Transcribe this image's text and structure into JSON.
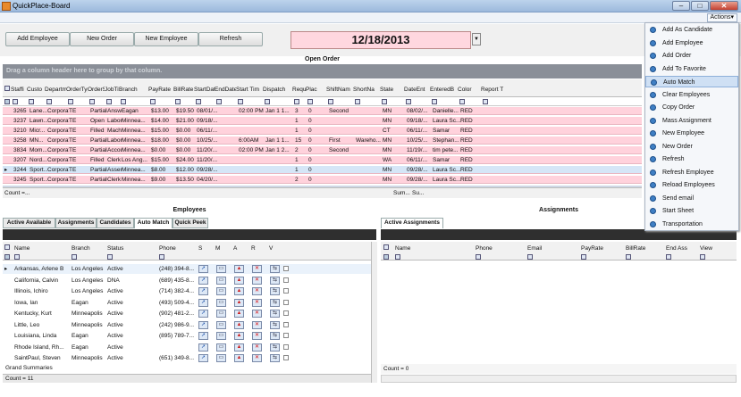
{
  "window": {
    "title": "QuickPlace-Board",
    "actions_label": "Actions"
  },
  "toolbar": {
    "add_employee": "Add Employee",
    "new_order": "New Order",
    "new_employee": "New Employee",
    "refresh": "Refresh",
    "date": "12/18/2013"
  },
  "open_order": {
    "title": "Open Order",
    "group_hint": "Drag a column header here to group by that column.",
    "columns": [
      "Staffi",
      "Custo",
      "Departmen",
      "OrderTyp",
      "OrderSta",
      "JobTitle",
      "Branch",
      "PayRate",
      "BillRate",
      "StartDat",
      "EndDate",
      "Start Tim",
      "Dispatch",
      "Requi",
      "Plac",
      "ShiftNam",
      "ShortNa",
      "State",
      "DateEnt",
      "EnteredB",
      "Color",
      "Report T"
    ],
    "rows": [
      [
        "3265",
        "Lane...",
        "Corporate",
        "TE",
        "Partially...",
        "Answeri...",
        "Eagan",
        "$13.00",
        "$19.50",
        "08/01/...",
        "",
        "02:00 PM",
        "Jan 1 1...",
        "3",
        "0",
        "Second",
        "",
        "MN",
        "08/02/...",
        "Danielle...",
        "RED",
        ""
      ],
      [
        "3237",
        "Lawn...",
        "Corporate",
        "TE",
        "Open",
        "Labor",
        "Minnea...",
        "$14.00",
        "$21.00",
        "09/18/...",
        "",
        "",
        "",
        "1",
        "0",
        "",
        "",
        "MN",
        "09/18/...",
        "Laura Sc...",
        "RED",
        ""
      ],
      [
        "3210",
        "Micr...",
        "Corporate",
        "TE",
        "Filled",
        "Machinist",
        "Minnea...",
        "$15.00",
        "$0.00",
        "06/11/...",
        "",
        "",
        "",
        "1",
        "0",
        "",
        "",
        "CT",
        "06/11/...",
        "Samar",
        "RED",
        ""
      ],
      [
        "3258",
        "MN...",
        "Corporate",
        "TE",
        "Partially...",
        "Labor",
        "Minnea...",
        "$18.00",
        "$0.00",
        "10/25/...",
        "",
        "6:00AM",
        "Jan 1 1...",
        "15",
        "0",
        "First",
        "Wareho...",
        "MN",
        "10/25/...",
        "Stephan...",
        "RED",
        ""
      ],
      [
        "3834",
        "Mom...",
        "Corporate",
        "TE",
        "Partially...",
        "Account...",
        "Minnea...",
        "$0.00",
        "$0.00",
        "11/20/...",
        "",
        "02:00 PM",
        "Jan 1 2...",
        "2",
        "0",
        "Second",
        "",
        "MN",
        "11/19/...",
        "tim pete...",
        "RED",
        ""
      ],
      [
        "3207",
        "Nord...",
        "Corporate",
        "TE",
        "Filled",
        "Clerk",
        "Los Ang...",
        "$15.00",
        "$24.00",
        "11/20/...",
        "",
        "",
        "",
        "1",
        "0",
        "",
        "",
        "WA",
        "06/11/...",
        "Samar",
        "RED",
        ""
      ],
      [
        "3244",
        "Sport...",
        "Corporate",
        "TE",
        "Partially...",
        "Assembly",
        "Minnea...",
        "$8.00",
        "$12.00",
        "09/28/...",
        "",
        "",
        "",
        "1",
        "0",
        "",
        "",
        "MN",
        "09/28/...",
        "Laura Sc...",
        "RED",
        ""
      ],
      [
        "3245",
        "Sport...",
        "Corporate",
        "TE",
        "Partially...",
        "Clerk",
        "Minnea...",
        "$9.00",
        "$13.50",
        "04/20/...",
        "",
        "",
        "",
        "2",
        "0",
        "",
        "",
        "MN",
        "09/28/...",
        "Laura Sc...",
        "RED",
        ""
      ]
    ],
    "footer_count": "Count =...",
    "footer_sum1": "Sum...",
    "footer_sum2": "Su..."
  },
  "employees": {
    "title": "Employees",
    "tabs": [
      "Active Available",
      "Assignments",
      "Candidates",
      "Auto Match",
      "Quick Peek"
    ],
    "active_tab": "Auto Match",
    "columns": [
      "Name",
      "Branch",
      "Status",
      "Phone",
      "S",
      "M",
      "A",
      "R",
      "V"
    ],
    "rows": [
      [
        "Arkansas, Arlene B",
        "Los Angeles",
        "Active",
        "(248) 394-8..."
      ],
      [
        "California, Calvin",
        "Los Angeles",
        "DNA",
        "(689) 435-8..."
      ],
      [
        "Illinois, Ichiro",
        "Los Angeles",
        "Active",
        "(714) 382-4..."
      ],
      [
        "Iowa, Ian",
        "Eagan",
        "Active",
        "(493) 509-4..."
      ],
      [
        "Kentucky, Kurt",
        "Minneapolis",
        "Active",
        "(902) 481-2..."
      ],
      [
        "Little, Leo",
        "Minneapolis",
        "Active",
        "(242) 986-9..."
      ],
      [
        "Louisiana, Linda",
        "Eagan",
        "Active",
        "(895) 789-7..."
      ],
      [
        "Rhode Island, Rh...",
        "Eagan",
        "Active",
        ""
      ],
      [
        "SaintPaul, Steven",
        "Minneapolis",
        "Active",
        "(651) 349-8..."
      ]
    ],
    "grand_summaries": "Grand Summaries",
    "count": "Count = 11"
  },
  "assignments": {
    "title": "Assignments",
    "tab": "Active Assignments",
    "columns": [
      "Name",
      "Phone",
      "Email",
      "PayRate",
      "BillRate",
      "End Ass",
      "View"
    ],
    "count": "Count = 0"
  },
  "actions_menu": [
    "Add As Candidate",
    "Add Employee",
    "Add Order",
    "Add To Favorite",
    "Auto Match",
    "Clear Employees",
    "Copy Order",
    "Mass Assignment",
    "New Employee",
    "New Order",
    "Refresh",
    "Refresh Employee",
    "Reload Employees",
    "Send email",
    "Start Sheet",
    "Transportation"
  ],
  "actions_highlighted": "Auto Match"
}
